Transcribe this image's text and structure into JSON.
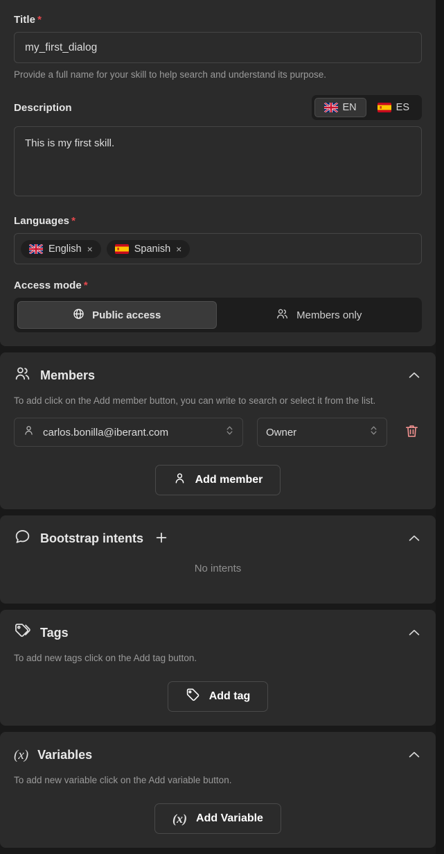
{
  "form": {
    "title": {
      "label": "Title",
      "required": true,
      "value": "my_first_dialog",
      "placeholder": "",
      "helper": "Provide a full name for your skill to help search and understand its purpose."
    },
    "description": {
      "label": "Description",
      "value": "This is my first skill.",
      "placeholder": "",
      "lang_toggle": [
        {
          "code": "EN",
          "flag": "uk-flag-icon",
          "active": true
        },
        {
          "code": "ES",
          "flag": "spain-flag-icon",
          "active": false
        }
      ]
    },
    "languages": {
      "label": "Languages",
      "required": true,
      "chips": [
        {
          "label": "English",
          "flag": "uk-flag-icon",
          "remove": "×"
        },
        {
          "label": "Spanish",
          "flag": "spain-flag-icon",
          "remove": "×"
        }
      ]
    },
    "access_mode": {
      "label": "Access mode",
      "required": true,
      "options": [
        {
          "label": "Public access",
          "icon": "globe-icon",
          "active": true
        },
        {
          "label": "Members only",
          "icon": "users-icon",
          "active": false
        }
      ]
    }
  },
  "sections": {
    "members": {
      "title": "Members",
      "icon": "users-icon",
      "collapse_icon": "chevron-up-icon",
      "description": "To add click on the Add member button, you can write to search or select it from the list.",
      "rows": [
        {
          "member": "carlos.bonilla@iberant.com",
          "member_icon": "user-icon",
          "role": "Owner",
          "delete_icon": "trash-icon"
        }
      ],
      "add_button": {
        "label": "Add member",
        "icon": "user-icon"
      }
    },
    "bootstrap_intents": {
      "title": "Bootstrap intents",
      "icon": "chat-bubble-icon",
      "add_icon": "plus-icon",
      "collapse_icon": "chevron-up-icon",
      "empty_text": "No intents"
    },
    "tags": {
      "title": "Tags",
      "icon": "tags-icon",
      "collapse_icon": "chevron-up-icon",
      "description": "To add new tags click on the Add tag button.",
      "add_button": {
        "label": "Add tag",
        "icon": "tag-icon"
      }
    },
    "variables": {
      "title": "Variables",
      "icon": "variable-icon",
      "icon_glyph": "(x)",
      "collapse_icon": "chevron-up-icon",
      "description": "To add new variable click on the Add variable button.",
      "add_button": {
        "label": "Add Variable",
        "icon": "variable-icon",
        "icon_glyph": "(x)"
      }
    }
  },
  "colors": {
    "page_background": "#191919",
    "card_background": "#2b2b2b",
    "inset_background": "#1d1d1d",
    "required_asterisk": "#e5484d",
    "trash_icon": "#f0918f",
    "text_primary": "#e4e4e4",
    "text_muted": "#9a9a9a"
  }
}
